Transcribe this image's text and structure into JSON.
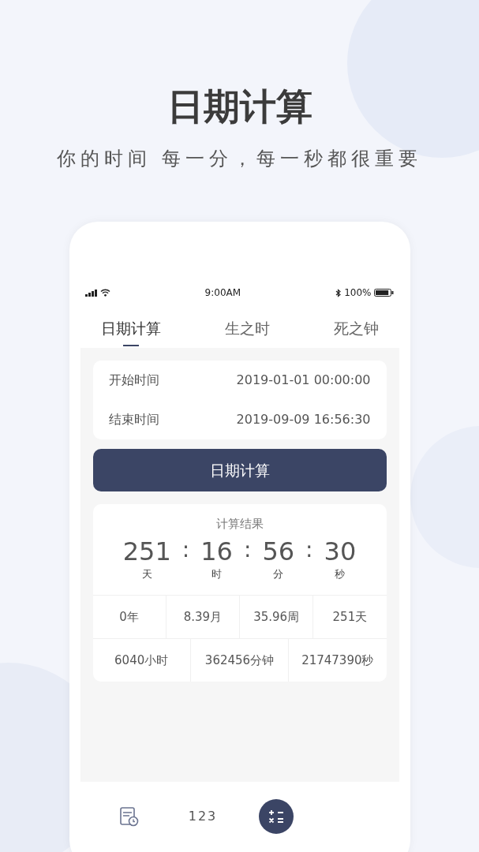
{
  "header": {
    "title": "日期计算",
    "subtitle": "你的时间 每一分，每一秒都很重要"
  },
  "status_bar": {
    "time": "9:00AM",
    "battery_text": "100%",
    "battery": {
      "level": 0.9
    }
  },
  "tabs": [
    {
      "label": "日期计算",
      "selected": true
    },
    {
      "label": "生之时",
      "selected": false
    },
    {
      "label": "死之钟",
      "selected": false
    }
  ],
  "fields": [
    {
      "label": "开始时间",
      "value": "2019-01-01 00:00:00"
    },
    {
      "label": "结束时间",
      "value": "2019-09-09 16:56:30"
    }
  ],
  "button": "日期计算",
  "result": {
    "title": "计算结果",
    "units": [
      {
        "value": "251",
        "unit": "天"
      },
      {
        "separator": ":",
        "value": "16",
        "unit": "时"
      },
      {
        "separator": ":",
        "value": "56",
        "unit": "分"
      },
      {
        "separator": ":",
        "value": "30",
        "unit": "秒"
      }
    ],
    "grid": [
      [
        "0年",
        "8.39月",
        "35.96周",
        "251天"
      ],
      [
        "6040小时",
        "362456分钟",
        "21747390秒"
      ]
    ]
  },
  "nav": [
    {
      "kind": "calendar",
      "selected": false
    },
    {
      "kind": "text",
      "label": "123",
      "selected": false
    },
    {
      "kind": "calculator",
      "selected": true
    }
  ]
}
